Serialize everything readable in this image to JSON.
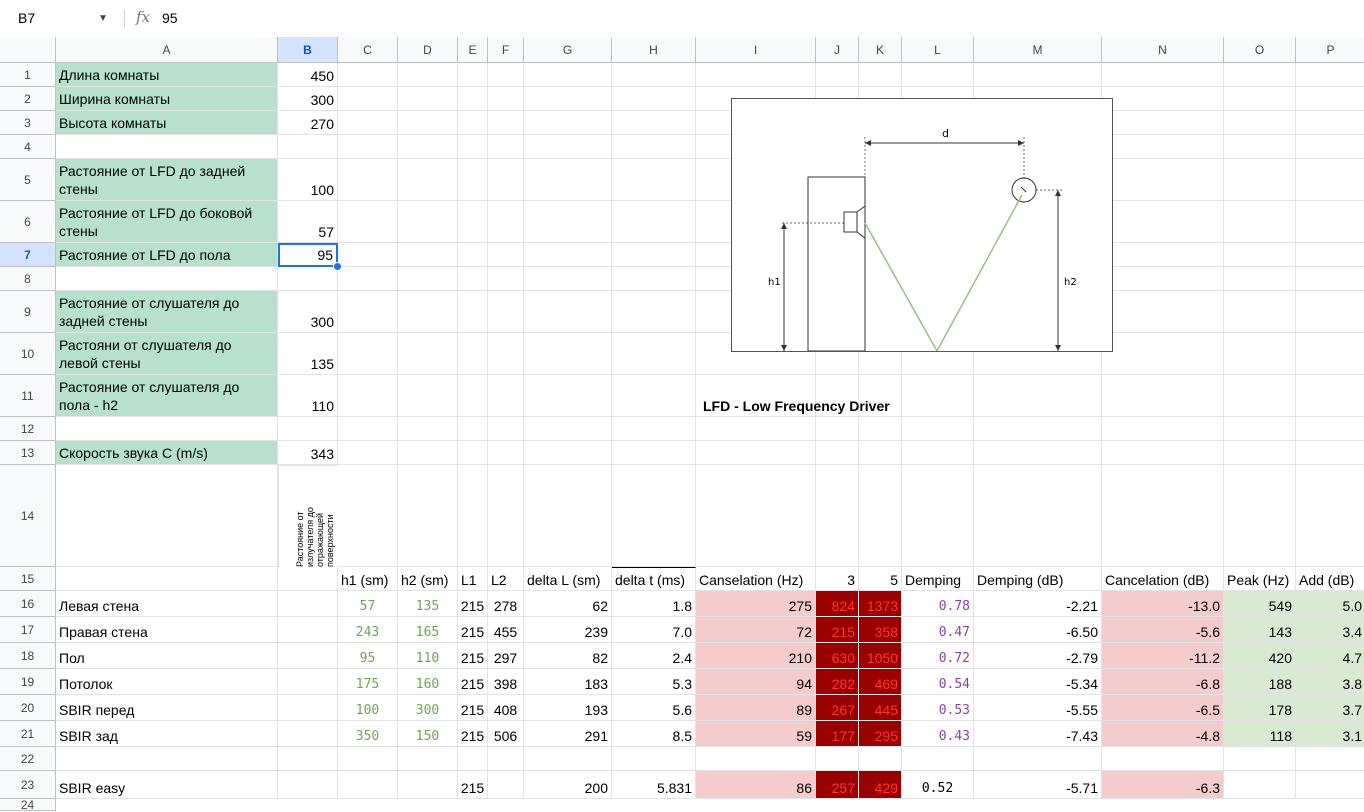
{
  "formula_bar": {
    "cell_ref": "B7",
    "fx_label": "fx",
    "value": "95"
  },
  "columns": [
    "A",
    "B",
    "C",
    "D",
    "E",
    "F",
    "G",
    "H",
    "I",
    "J",
    "K",
    "L",
    "M",
    "N",
    "O",
    "P"
  ],
  "selected_column": "B",
  "selected_row": "7",
  "rows": {
    "r1": {
      "num": "1",
      "a": "Длина комнаты",
      "b": "450"
    },
    "r2": {
      "num": "2",
      "a": "Ширина комнаты",
      "b": "300"
    },
    "r3": {
      "num": "3",
      "a": "Высота комнаты",
      "b": "270"
    },
    "r4": {
      "num": "4"
    },
    "r5": {
      "num": "5",
      "a": "Растояние от LFD до задней стены",
      "b": "100"
    },
    "r6": {
      "num": "6",
      "a": "Растояние от LFD до боковой стены",
      "b": "57"
    },
    "r7": {
      "num": "7",
      "a": "Растояние от LFD до пола",
      "b": "95"
    },
    "r8": {
      "num": "8"
    },
    "r9": {
      "num": "9",
      "a": "Растояние от слушателя до задней стены",
      "b": "300"
    },
    "r10": {
      "num": "10",
      "a": "Растояни от слушателя до левой стены",
      "b": "135"
    },
    "r11": {
      "num": "11",
      "a": "Растояние от слушателя до пола - h2",
      "b": "110"
    },
    "r12": {
      "num": "12"
    },
    "r13": {
      "num": "13",
      "a": "Скорость звука C (m/s)",
      "b": "343"
    },
    "r14": {
      "num": "14",
      "b": "Растояние от излучателя до отражающей поверхности"
    },
    "r15": {
      "num": "15"
    }
  },
  "table_headers": {
    "c": "h1 (sm)",
    "d": "h2 (sm)",
    "e": "L1",
    "f": "L2",
    "g": "delta L (sm)",
    "h": "delta t (ms)",
    "i": "Canselation (Hz)",
    "j": "3",
    "k": "5",
    "l": "Demping",
    "m": "Demping (dB)",
    "n": "Cancelation (dB)",
    "o": "Peak (Hz)",
    "p": "Add (dB)"
  },
  "table_rows": [
    {
      "num": "16",
      "a": "Левая стена",
      "c": "57",
      "d": "135",
      "e": "215",
      "f": "278",
      "g": "62",
      "h": "1.8",
      "i": "275",
      "j": "824",
      "k": "1373",
      "l": "0.78",
      "m": "-2.21",
      "n": "-13.0",
      "o": "549",
      "p": "5.0"
    },
    {
      "num": "17",
      "a": "Правая стена",
      "c": "243",
      "d": "165",
      "e": "215",
      "f": "455",
      "g": "239",
      "h": "7.0",
      "i": "72",
      "j": "215",
      "k": "358",
      "l": "0.47",
      "m": "-6.50",
      "n": "-5.6",
      "o": "143",
      "p": "3.4"
    },
    {
      "num": "18",
      "a": "Пол",
      "c": "95",
      "d": "110",
      "e": "215",
      "f": "297",
      "g": "82",
      "h": "2.4",
      "i": "210",
      "j": "630",
      "k": "1050",
      "l": "0.72",
      "m": "-2.79",
      "n": "-11.2",
      "o": "420",
      "p": "4.7"
    },
    {
      "num": "19",
      "a": "Потолок",
      "c": "175",
      "d": "160",
      "e": "215",
      "f": "398",
      "g": "183",
      "h": "5.3",
      "i": "94",
      "j": "282",
      "k": "469",
      "l": "0.54",
      "m": "-5.34",
      "n": "-6.8",
      "o": "188",
      "p": "3.8"
    },
    {
      "num": "20",
      "a": "SBIR перед",
      "c": "100",
      "d": "300",
      "e": "215",
      "f": "408",
      "g": "193",
      "h": "5.6",
      "i": "89",
      "j": "267",
      "k": "445",
      "l": "0.53",
      "m": "-5.55",
      "n": "-6.5",
      "o": "178",
      "p": "3.7"
    },
    {
      "num": "21",
      "a": "SBIR зад",
      "c": "350",
      "d": "150",
      "e": "215",
      "f": "506",
      "g": "291",
      "h": "8.5",
      "i": "59",
      "j": "177",
      "k": "295",
      "l": "0.43",
      "m": "-7.43",
      "n": "-4.8",
      "o": "118",
      "p": "3.1"
    }
  ],
  "row22": {
    "num": "22"
  },
  "row23": {
    "num": "23",
    "a": "SBIR easy",
    "e": "215",
    "g": "200",
    "h": "5.831",
    "i": "86",
    "j": "257",
    "k": "429",
    "l": "0.52",
    "m": "-5.71",
    "n": "-6.3"
  },
  "row24": {
    "num": "24"
  },
  "diagram": {
    "label_d": "d",
    "label_h1": "h1",
    "label_h2": "h2"
  },
  "caption": "LFD - Low Frequency Driver",
  "colors": {
    "green": "#b7e1cd",
    "pink": "#f4cccc",
    "dark_red": "#990000",
    "light_green": "#d9ead3",
    "selection": "#1a73e8"
  }
}
